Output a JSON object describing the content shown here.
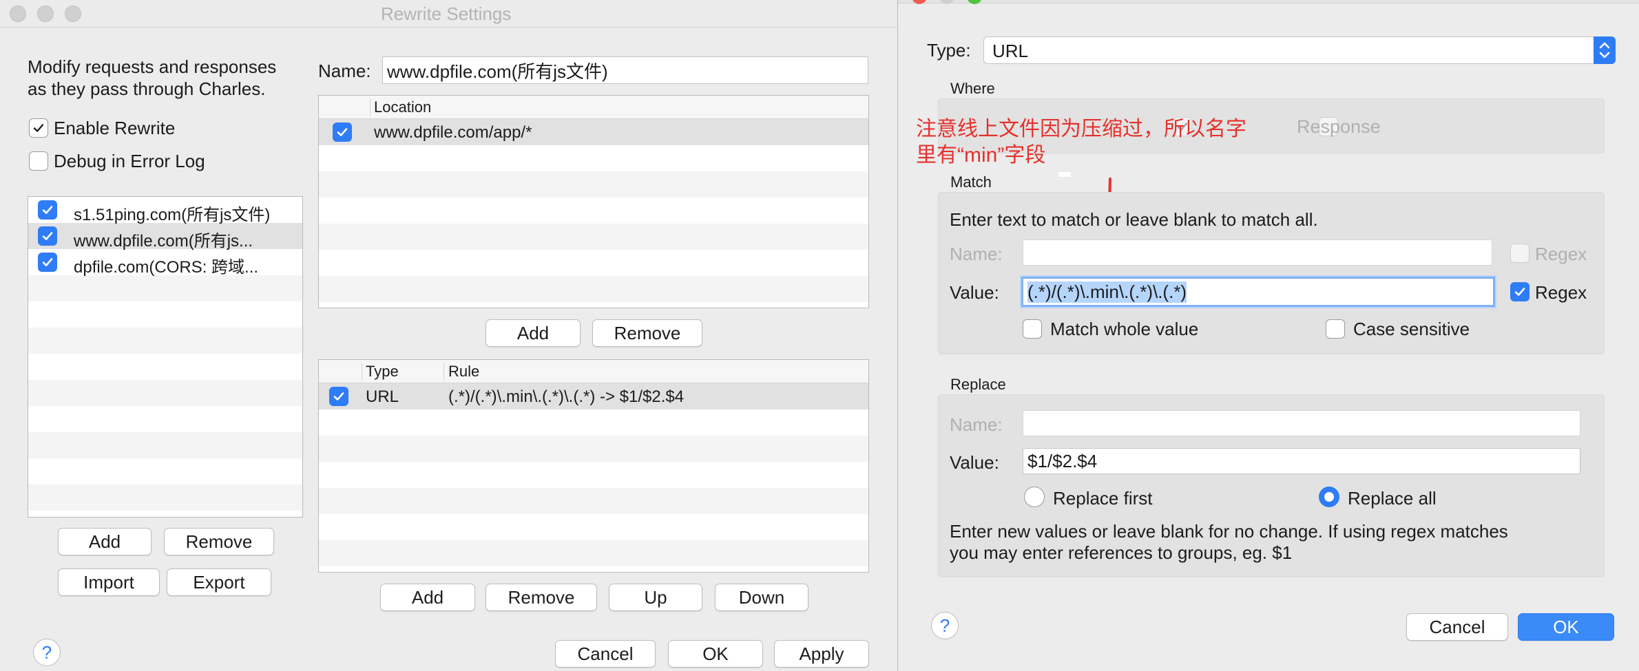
{
  "left_window": {
    "title": "Rewrite Settings",
    "description_line1": "Modify requests and responses",
    "description_line2": "as they pass through Charles.",
    "enable_rewrite": {
      "label": "Enable Rewrite",
      "checked": true
    },
    "debug_log": {
      "label": "Debug in Error Log",
      "checked": false
    },
    "sets": [
      {
        "label": "s1.51ping.com(所有js文件)",
        "checked": true,
        "selected": false
      },
      {
        "label": "www.dpfile.com(所有js...",
        "checked": true,
        "selected": true
      },
      {
        "label": "dpfile.com(CORS: 跨域...",
        "checked": true,
        "selected": false
      }
    ],
    "sets_buttons": {
      "add": "Add",
      "remove": "Remove",
      "import": "Import",
      "export": "Export"
    },
    "name_label": "Name:",
    "name_value": "www.dpfile.com(所有js文件)",
    "location_header": "Location",
    "locations": [
      {
        "value": "www.dpfile.com/app/*",
        "checked": true
      }
    ],
    "location_buttons": {
      "add": "Add",
      "remove": "Remove"
    },
    "rules_headers": {
      "type": "Type",
      "rule": "Rule"
    },
    "rules": [
      {
        "type": "URL",
        "rule": "(.*)/(.*)\\.min\\.(.*)\\.(.*) -> $1/$2.$4",
        "checked": true
      }
    ],
    "rules_buttons": {
      "add": "Add",
      "remove": "Remove",
      "up": "Up",
      "down": "Down"
    },
    "footer_buttons": {
      "cancel": "Cancel",
      "ok": "OK",
      "apply": "Apply"
    },
    "help": "?"
  },
  "right_window": {
    "type_label": "Type:",
    "type_value": "URL",
    "where_label": "Where",
    "where_response_label": "Response",
    "annotation_line1": "注意线上文件因为压缩过，所以名字",
    "annotation_line2": "里有“min”字段",
    "match": {
      "label": "Match",
      "instruction": "Enter text to match or leave blank to match all.",
      "name_label": "Name:",
      "name_value": "",
      "name_regex_label": "Regex",
      "value_label": "Value:",
      "value": "(.*)/(.*)\\.min\\.(.*)\\.(.*)",
      "value_regex_label": "Regex",
      "value_regex_checked": true,
      "match_whole_value": "Match whole value",
      "case_sensitive": "Case sensitive"
    },
    "replace": {
      "label": "Replace",
      "name_label": "Name:",
      "name_value": "",
      "value_label": "Value:",
      "value": "$1/$2.$4",
      "replace_first": "Replace first",
      "replace_all": "Replace all",
      "selected": "Replace all",
      "help_line1": "Enter new values or leave blank for no change. If using regex matches",
      "help_line2": "you may enter references to groups, eg. $1"
    },
    "footer_buttons": {
      "cancel": "Cancel",
      "ok": "OK"
    },
    "help": "?"
  },
  "colors": {
    "accent": "#2e7cf6",
    "annotation": "#e5312c"
  }
}
